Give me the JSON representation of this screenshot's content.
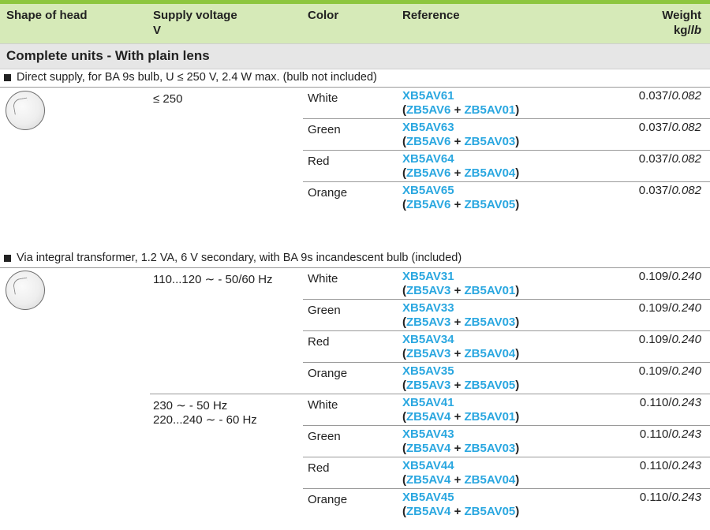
{
  "header": {
    "shape": "Shape of head",
    "voltage": "Supply voltage",
    "voltage_unit": "V",
    "color": "Color",
    "reference": "Reference",
    "weight": "Weight",
    "weight_unit_kg": "kg/",
    "weight_unit_lb": "lb"
  },
  "section_title": "Complete units - With plain lens",
  "groups": [
    {
      "title": "Direct supply, for BA 9s bulb, U ≤ 250 V, 2.4 W max. (bulb not included)",
      "voltages": [
        "≤ 250"
      ],
      "rows": [
        {
          "color": "White",
          "ref": "XB5AV61",
          "p1": "ZB5AV6",
          "p2": "ZB5AV01",
          "kg": "0.037/",
          "lb": "0.082"
        },
        {
          "color": "Green",
          "ref": "XB5AV63",
          "p1": "ZB5AV6",
          "p2": "ZB5AV03",
          "kg": "0.037/",
          "lb": "0.082"
        },
        {
          "color": "Red",
          "ref": "XB5AV64",
          "p1": "ZB5AV6",
          "p2": "ZB5AV04",
          "kg": "0.037/",
          "lb": "0.082"
        },
        {
          "color": "Orange",
          "ref": "XB5AV65",
          "p1": "ZB5AV6",
          "p2": "ZB5AV05",
          "kg": "0.037/",
          "lb": "0.082"
        }
      ]
    },
    {
      "title": "Via integral transformer, 1.2 VA,  6 V secondary, with BA 9s incandescent bulb (included)",
      "voltages": [
        "110...120 ∼ - 50/60 Hz",
        "230 ∼ - 50 Hz",
        "220...240 ∼ - 60 Hz"
      ],
      "rows": [
        {
          "color": "White",
          "ref": "XB5AV31",
          "p1": "ZB5AV3",
          "p2": "ZB5AV01",
          "kg": "0.109/",
          "lb": "0.240"
        },
        {
          "color": "Green",
          "ref": "XB5AV33",
          "p1": "ZB5AV3",
          "p2": "ZB5AV03",
          "kg": "0.109/",
          "lb": "0.240"
        },
        {
          "color": "Red",
          "ref": "XB5AV34",
          "p1": "ZB5AV3",
          "p2": "ZB5AV04",
          "kg": "0.109/",
          "lb": "0.240"
        },
        {
          "color": "Orange",
          "ref": "XB5AV35",
          "p1": "ZB5AV3",
          "p2": "ZB5AV05",
          "kg": "0.109/",
          "lb": "0.240"
        },
        {
          "color": "White",
          "ref": "XB5AV41",
          "p1": "ZB5AV4",
          "p2": "ZB5AV01",
          "kg": "0.110/",
          "lb": "0.243"
        },
        {
          "color": "Green",
          "ref": "XB5AV43",
          "p1": "ZB5AV4",
          "p2": "ZB5AV03",
          "kg": "0.110/",
          "lb": "0.243"
        },
        {
          "color": "Red",
          "ref": "XB5AV44",
          "p1": "ZB5AV4",
          "p2": "ZB5AV04",
          "kg": "0.110/",
          "lb": "0.243"
        },
        {
          "color": "Orange",
          "ref": "XB5AV45",
          "p1": "ZB5AV4",
          "p2": "ZB5AV05",
          "kg": "0.110/",
          "lb": "0.243"
        }
      ]
    }
  ],
  "colors": {
    "accent_green": "#8dc63f",
    "header_bg": "#d6eab8",
    "link_blue": "#2aa7e0",
    "section_bg": "#e6e6e6"
  }
}
